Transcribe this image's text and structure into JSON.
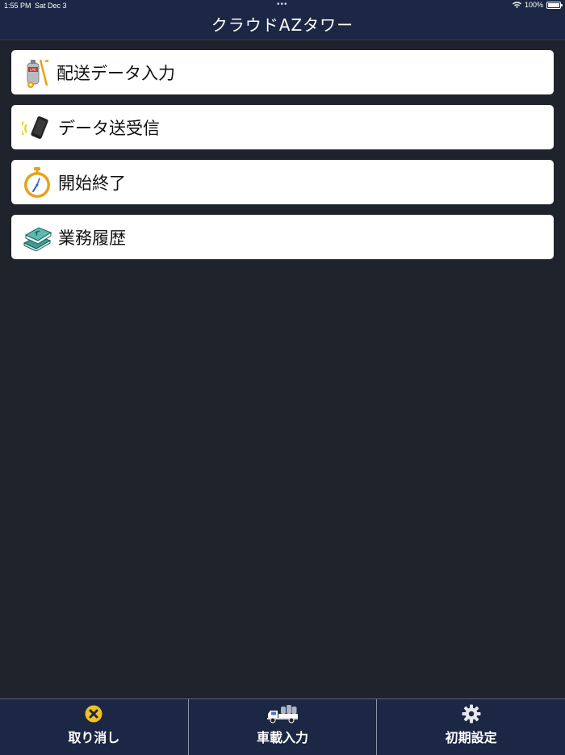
{
  "status_bar": {
    "time": "1:55 PM",
    "date": "Sat Dec 3",
    "battery": "100%",
    "dots": "•••"
  },
  "header": {
    "title": "クラウドAZタワー"
  },
  "menu": [
    {
      "label": "配送データ入力",
      "icon": "gas-cylinder-cart-icon"
    },
    {
      "label": "データ送受信",
      "icon": "phone-transmit-icon"
    },
    {
      "label": "開始終了",
      "icon": "stopwatch-icon"
    },
    {
      "label": "業務履歴",
      "icon": "stacked-books-icon"
    }
  ],
  "tab_bar": [
    {
      "label": "取り消し",
      "icon": "cancel-x-icon"
    },
    {
      "label": "車載入力",
      "icon": "truck-icon"
    },
    {
      "label": "初期設定",
      "icon": "gear-icon"
    }
  ],
  "colors": {
    "header_bg": "#1c2745",
    "page_bg": "#1f232c",
    "card_bg": "#ffffff",
    "cancel_icon": "#f2c11b"
  }
}
